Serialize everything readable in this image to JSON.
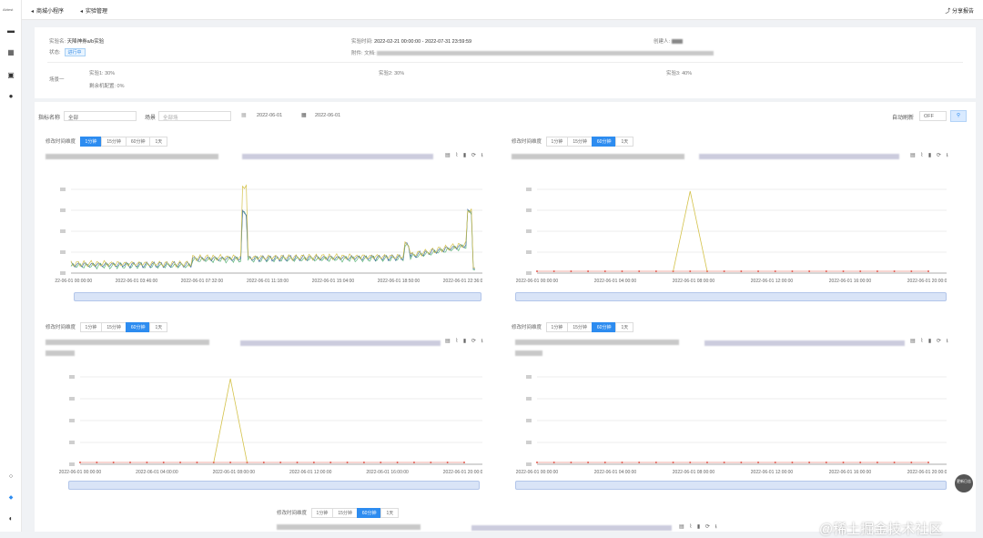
{
  "app": {
    "logo_text": "Abtest"
  },
  "sidebar": {
    "icons": [
      "monitor-icon",
      "calendar-icon",
      "report-icon",
      "user-icon",
      "settings-icon",
      "dot-icon",
      "avatar-icon"
    ]
  },
  "header": {
    "crumbs": [
      "商城小程序",
      "实验管理"
    ],
    "share_label": "分享报告"
  },
  "experiment": {
    "name_label": "实验名:",
    "name_value": "天降神券a/b实验",
    "status_label": "状态:",
    "status_value": "进行中",
    "time_label": "实验时间:",
    "time_value": "2022-02-21 00:00:00 - 2022-07-31 23:59:59",
    "creator_label": "创建人:",
    "doc_label": "附件:",
    "doc_value": "文档:",
    "scene_label": "场景一",
    "exp1": "实验1:  30%",
    "exp2": "实验2:  30%",
    "exp3": "实验3:  40%",
    "leftover": "剩余机配置:  0%"
  },
  "filters": {
    "metric_label": "指标名称",
    "metric_value": "全部",
    "scene_label": "场景",
    "scene_value": "全部场",
    "date_start": "2022-06-01",
    "date_end": "2022-06-01",
    "auto_refresh_label": "自动刷新",
    "auto_refresh_value": "OFF"
  },
  "granularity": {
    "label": "修改时间维度",
    "options": [
      "1分钟",
      "15分钟",
      "60分钟",
      "1天"
    ]
  },
  "charts": {
    "c1": {
      "active": 0,
      "xticks": [
        "2022-06-01 00:00:00",
        "2022-06-01 03:46:00",
        "2022-06-01 07:32:00",
        "2022-06-01 11:18:00",
        "2022-06-01 15:04:00",
        "2022-06-01 18:50:00",
        "2022-06-01 22:36:00"
      ]
    },
    "c2": {
      "active": 2,
      "xticks": [
        "2022-06-01 00:00:00",
        "2022-06-01 04:00:00",
        "2022-06-01 08:00:00",
        "2022-06-01 12:00:00",
        "2022-06-01 16:00:00",
        "2022-06-01 20:00:00"
      ]
    },
    "c3": {
      "active": 2,
      "xticks": [
        "2022-06-01 00:00:00",
        "2022-06-01 04:00:00",
        "2022-06-01 08:00:00",
        "2022-06-01 12:00:00",
        "2022-06-01 16:00:00",
        "2022-06-01 20:00:00"
      ]
    },
    "c4": {
      "active": 2,
      "xticks": [
        "2022-06-01 00:00:00",
        "2022-06-01 04:00:00",
        "2022-06-01 08:00:00",
        "2022-06-01 12:00:00",
        "2022-06-01 16:00:00",
        "2022-06-01 20:00:00"
      ]
    },
    "c5": {
      "active": 2
    }
  },
  "colors": {
    "accent": "#2d8cf0",
    "yellow": "#d4c24a",
    "green": "#5bb377",
    "blue": "#4a6fa5",
    "red": "#e05a4f"
  },
  "fab_label": "更新日志",
  "watermark": "@稀土掘金技术社区"
}
